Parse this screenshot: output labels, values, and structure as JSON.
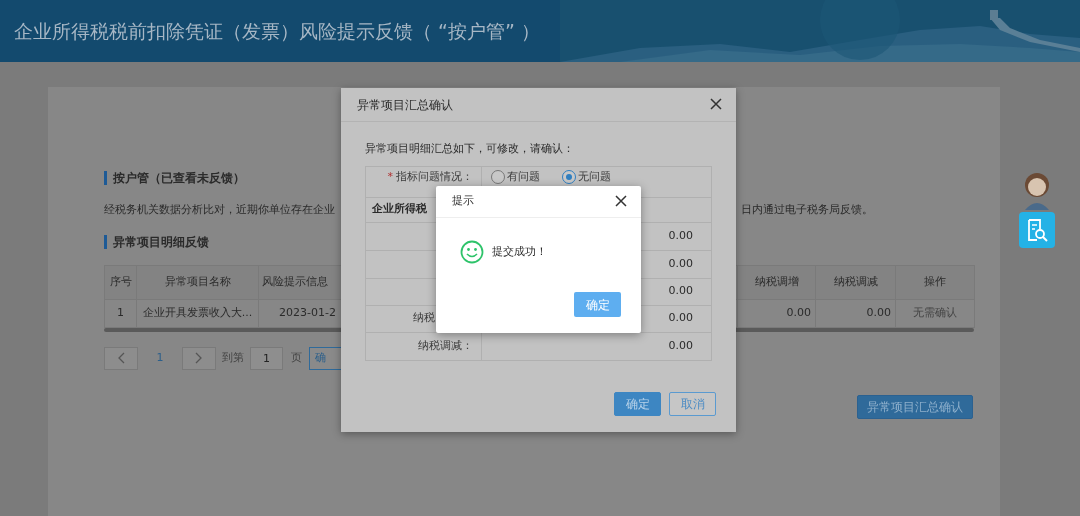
{
  "header": {
    "title": "企业所得税税前扣除凭证（发票）风险提示反馈（ “按户管” ）"
  },
  "page": {
    "section_title": "按户管（已查看未反馈）",
    "notice_left": "经税务机关数据分析比对，近期你单位存在企业",
    "notice_right": "日内通过电子税务局反馈。",
    "table_title": "异常项目明细反馈",
    "table": {
      "left_columns": [
        "序号",
        "异常项目名称",
        "风险提示信息"
      ],
      "right_columns": [
        "纳税调增",
        "纳税调减",
        "操作"
      ],
      "rows": [
        {
          "left_cells": [
            "1",
            "企业开具发票收入大...",
            "2023-01-2"
          ],
          "right_cells": [
            "0.00",
            "0.00",
            "无需确认"
          ]
        }
      ]
    },
    "pagination": {
      "current_page": "1",
      "goto_label": "到第",
      "page_input": "1",
      "page_suffix": "页",
      "go_button": "确"
    },
    "summary_button": "异常项目汇总确认"
  },
  "dialog": {
    "title": "异常项目汇总确认",
    "intro": "异常项目明细汇总如下，可修改，请确认：",
    "question": {
      "required_mark": "*",
      "label": "指标问题情况：",
      "options": [
        {
          "label": "有问题",
          "selected": false
        },
        {
          "label": "无问题",
          "selected": true
        }
      ]
    },
    "section": "企业所得税",
    "rows": [
      {
        "value": "0.00"
      },
      {
        "value": "0.00"
      },
      {
        "value": "0.00"
      },
      {
        "label": "纳税",
        "value": "0.00"
      },
      {
        "label": "纳税调减：",
        "value": "0.00"
      }
    ],
    "buttons": [
      {
        "label": "确定",
        "kind": "primary"
      },
      {
        "label": "取消",
        "kind": "outline"
      }
    ]
  },
  "tip": {
    "title": "提示",
    "message": "提交成功！",
    "button": "确定"
  }
}
